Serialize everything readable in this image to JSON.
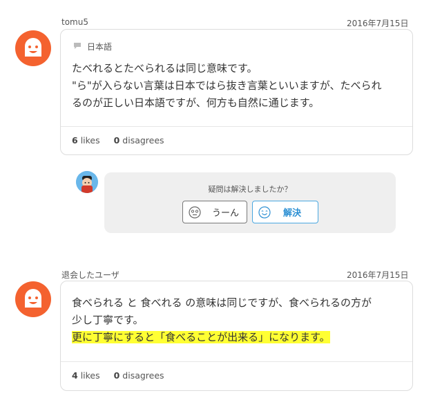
{
  "posts": [
    {
      "username": "tomu5",
      "date": "2016年7月15日",
      "language": "日本語",
      "lines": [
        "たべれるとたべられるは同じ意味です。",
        "\"ら\"が入らない言葉は日本ではら抜き言葉といいますが、たべられ",
        "るのが正しい日本語ですが、何方も自然に通じます。"
      ],
      "likes_count": "6",
      "likes_label": "likes",
      "disagrees_count": "0",
      "disagrees_label": "disagrees"
    },
    {
      "username": "退会したユーザ",
      "date": "2016年7月15日",
      "lines": [
        "食べられる と 食べれる の意味は同じですが、食べられるの方が",
        "少し丁寧です。"
      ],
      "highlighted_line": "更に丁寧にすると「食べることが出来る」になります。",
      "likes_count": "4",
      "likes_label": "likes",
      "disagrees_count": "0",
      "disagrees_label": "disagrees"
    }
  ],
  "resolution": {
    "question": "疑問は解決しましたか？",
    "hmm_label": "うーん",
    "solved_label": "解決"
  },
  "colors": {
    "avatar": "#f4622f",
    "highlight": "#ffff33",
    "solved_blue": "#2b8fd3",
    "panel_bg": "#efefef"
  },
  "icons": [
    "comment-bubble-icon",
    "thinking-face-icon",
    "smiling-face-icon"
  ]
}
